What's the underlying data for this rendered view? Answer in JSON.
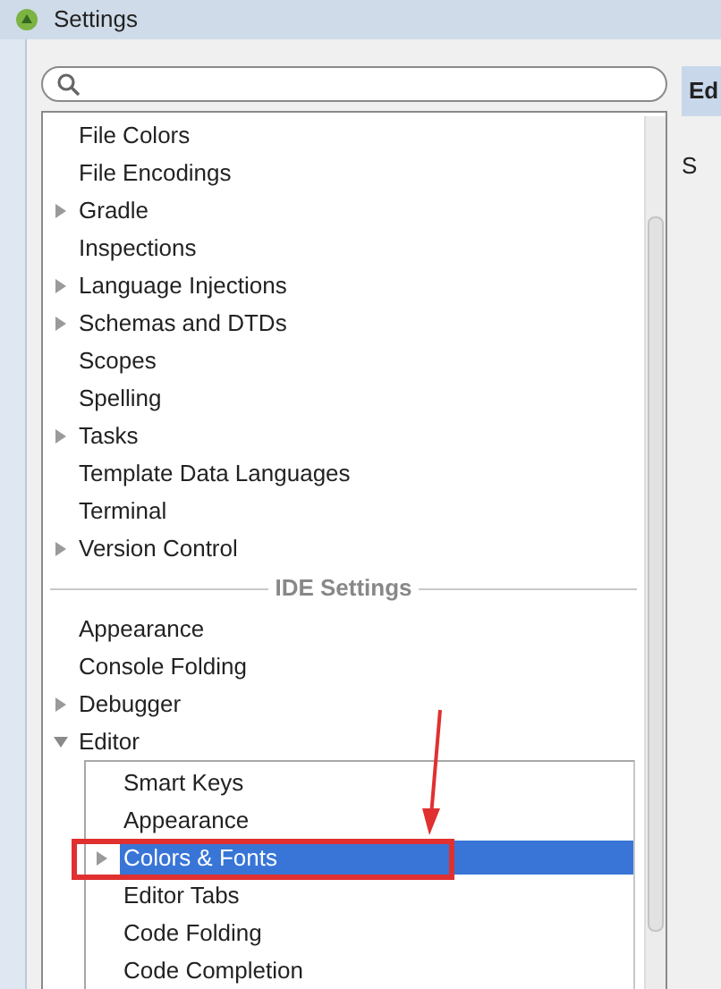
{
  "window": {
    "title": "Settings"
  },
  "project_items": [
    {
      "label": "File Colors",
      "kind": "leaf"
    },
    {
      "label": "File Encodings",
      "kind": "leaf"
    },
    {
      "label": "Gradle",
      "kind": "group",
      "expanded": false
    },
    {
      "label": "Inspections",
      "kind": "leaf"
    },
    {
      "label": "Language Injections",
      "kind": "group",
      "expanded": false
    },
    {
      "label": "Schemas and DTDs",
      "kind": "group",
      "expanded": false
    },
    {
      "label": "Scopes",
      "kind": "leaf"
    },
    {
      "label": "Spelling",
      "kind": "leaf"
    },
    {
      "label": "Tasks",
      "kind": "group",
      "expanded": false
    },
    {
      "label": "Template Data Languages",
      "kind": "leaf"
    },
    {
      "label": "Terminal",
      "kind": "leaf"
    },
    {
      "label": "Version Control",
      "kind": "group",
      "expanded": false
    }
  ],
  "section_title": "IDE Settings",
  "ide_items": [
    {
      "label": "Appearance",
      "kind": "leaf"
    },
    {
      "label": "Console Folding",
      "kind": "leaf"
    },
    {
      "label": "Debugger",
      "kind": "group",
      "expanded": false
    },
    {
      "label": "Editor",
      "kind": "group",
      "expanded": true,
      "children": [
        {
          "label": "Smart Keys",
          "kind": "leaf",
          "selected": false
        },
        {
          "label": "Appearance",
          "kind": "leaf",
          "selected": false
        },
        {
          "label": "Colors & Fonts",
          "kind": "group",
          "expanded": false,
          "selected": true
        },
        {
          "label": "Editor Tabs",
          "kind": "leaf",
          "selected": false
        },
        {
          "label": "Code Folding",
          "kind": "leaf",
          "selected": false
        },
        {
          "label": "Code Completion",
          "kind": "leaf",
          "selected": false
        }
      ]
    }
  ],
  "right_panel": {
    "tab": "Ed",
    "text": "S"
  }
}
